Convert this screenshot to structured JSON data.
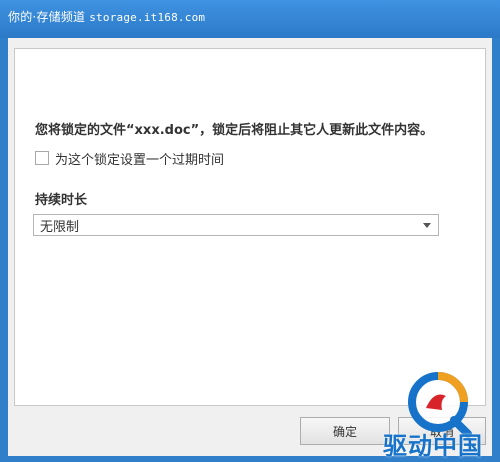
{
  "watermark": {
    "prefix": "你的·存储频道",
    "url": "storage.it168.com"
  },
  "message": "您将锁定的文件“xxx.doc”，锁定后将阻止其它人更新此文件内容。",
  "checkbox": {
    "label": "为这个锁定设置一个过期时间",
    "checked": false
  },
  "duration": {
    "label": "持续时长",
    "selected": "无限制"
  },
  "buttons": {
    "ok": "确定",
    "cancel": "取消"
  },
  "logo": {
    "text": "驱动中国"
  },
  "colors": {
    "title_bar": "#2f7fcb",
    "panel": "#ffffff",
    "dialog": "#f0f0f0",
    "logo": "#1673c9"
  }
}
